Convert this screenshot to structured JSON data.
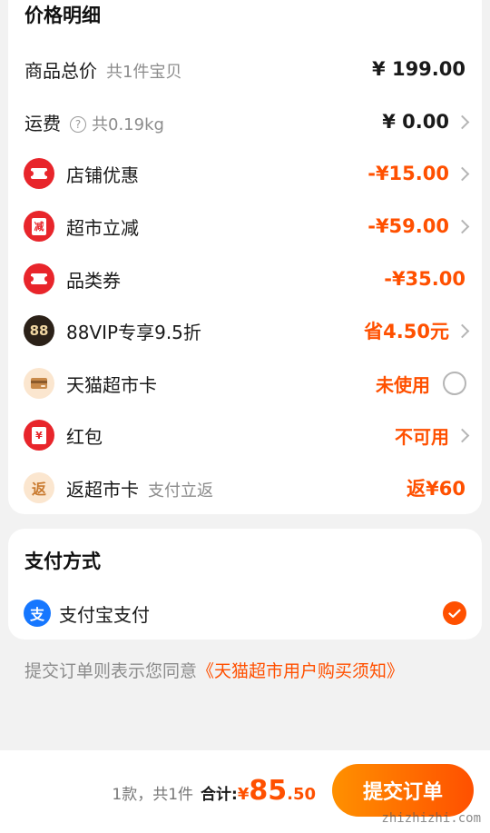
{
  "price_detail": {
    "title": "价格明细",
    "rows": [
      {
        "label": "商品总价",
        "sub": "共1件宝贝",
        "value": "¥ 199.00"
      },
      {
        "label": "运费",
        "sub": "共0.19kg",
        "value": "¥ 0.00"
      },
      {
        "label": "店铺优惠",
        "value": "-¥15.00"
      },
      {
        "label": "超市立减",
        "icon_text": "减",
        "value": "-¥59.00"
      },
      {
        "label": "品类券",
        "value": "-¥35.00"
      },
      {
        "label": "88VIP专享9.5折",
        "icon_text": "88",
        "value": "省4.50元"
      },
      {
        "label": "天猫超市卡",
        "value": "未使用"
      },
      {
        "label": "红包",
        "icon_text": "¥",
        "value": "不可用"
      },
      {
        "label": "返超市卡",
        "sub": "支付立返",
        "icon_text": "返",
        "value": "返¥60"
      }
    ]
  },
  "payment": {
    "title": "支付方式",
    "method_label": "支付宝支付",
    "method_icon_text": "支"
  },
  "agreement": {
    "prefix": "提交订单则表示您同意",
    "link": "《天猫超市用户购买须知》"
  },
  "bottom_bar": {
    "count_text": "1款，共1件",
    "total_label": "合计:",
    "currency": "¥",
    "total_int": "85",
    "total_dec": ".50",
    "submit_label": "提交订单"
  },
  "watermark": "zhizhizhi.com",
  "colors": {
    "accent": "#ff5000",
    "coupon_red": "#e8252b",
    "alipay_blue": "#1677ff",
    "vip_dark": "#2b2118"
  }
}
